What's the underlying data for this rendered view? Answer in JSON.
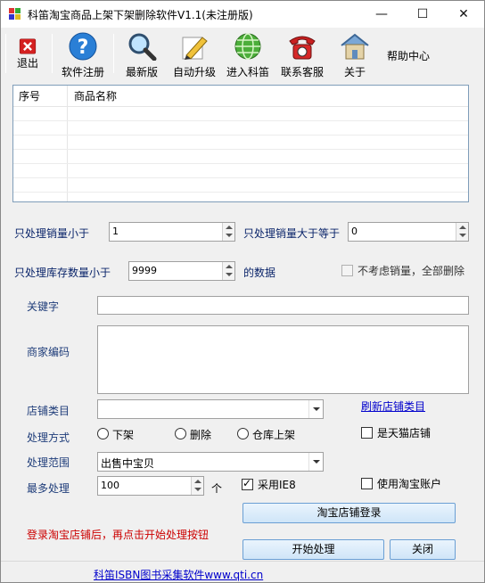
{
  "window": {
    "title": "科笛淘宝商品上架下架删除软件V1.1(未注册版)",
    "minimize_glyph": "—",
    "maximize_glyph": "☐",
    "close_glyph": "✕"
  },
  "toolbar": {
    "items": [
      {
        "label": "退出",
        "icon": "exit-icon"
      },
      {
        "label": "软件注册",
        "icon": "help-icon"
      },
      {
        "label": "最新版",
        "icon": "magnifier-icon"
      },
      {
        "label": "自动升级",
        "icon": "pencil-icon"
      },
      {
        "label": "进入科笛",
        "icon": "globe-icon"
      },
      {
        "label": "联系客服",
        "icon": "telephone-icon"
      },
      {
        "label": "关于",
        "icon": "house-icon"
      }
    ],
    "help_label": "帮助中心"
  },
  "list": {
    "columns": [
      "序号",
      "商品名称"
    ]
  },
  "filters": {
    "sales_lt_label": "只处理销量小于",
    "sales_lt_value": "1",
    "sales_gte_label": "只处理销量大于等于",
    "sales_gte_value": "0",
    "stock_lt_label": "只处理库存数量小于",
    "stock_lt_value": "9999",
    "stock_suffix": "的数据",
    "ignore_sales_label": "不考虑销量，全部删除"
  },
  "form": {
    "keyword_label": "关键字",
    "keyword_value": "",
    "merchant_code_label": "商家编码",
    "merchant_code_value": "",
    "category_label": "店铺类目",
    "category_value": "",
    "refresh_category_link": "刷新店铺类目",
    "method_label": "处理方式",
    "method_options": [
      "下架",
      "删除",
      "仓库上架"
    ],
    "tmall_label": "是天猫店铺",
    "scope_label": "处理范围",
    "scope_value": "出售中宝贝",
    "max_label": "最多处理",
    "max_value": "100",
    "max_unit": "个",
    "use_ie8_label": "采用IE8",
    "use_ie8_check": "✓",
    "use_taobao_label": "使用淘宝账户"
  },
  "buttons": {
    "login": "淘宝店铺登录",
    "start": "开始处理",
    "close": "关闭"
  },
  "hint": "登录淘宝店铺后，再点击开始处理按钮",
  "status": {
    "link_text": "科笛ISBN图书采集软件www.qti.cn"
  }
}
